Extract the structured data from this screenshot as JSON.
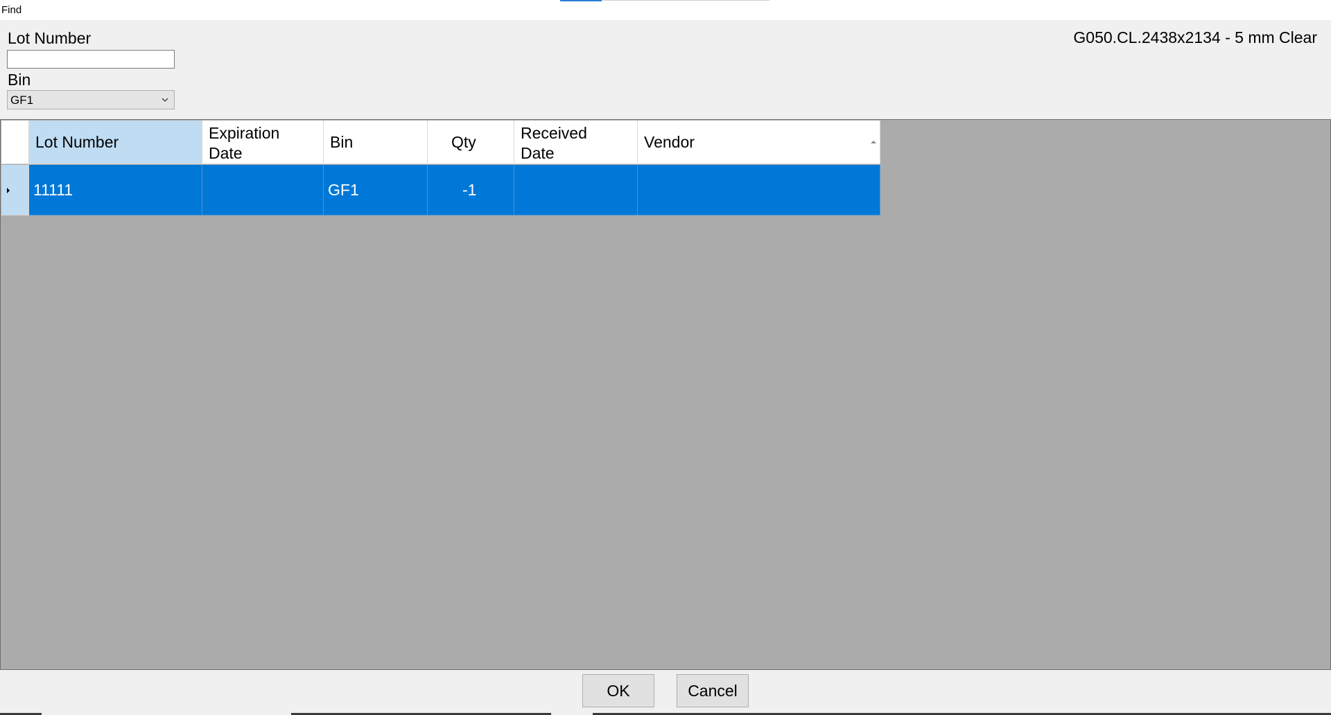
{
  "window": {
    "title": "Find"
  },
  "filters": {
    "lot_number_label": "Lot Number",
    "lot_number_value": "",
    "bin_label": "Bin",
    "bin_selected": "GF1"
  },
  "item_description": "G050.CL.2438x2134 - 5 mm Clear",
  "table": {
    "columns": [
      "Lot Number",
      "Expiration\nDate",
      "Bin",
      "Qty",
      "Received\nDate",
      "Vendor"
    ],
    "rows": [
      {
        "lot_number": "11111",
        "expiration_date": "",
        "bin": "GF1",
        "qty": "-1",
        "received_date": "",
        "vendor": ""
      }
    ],
    "selected_row": 0,
    "sorted_column": "Vendor",
    "sort_direction": "ascending"
  },
  "buttons": {
    "ok": "OK",
    "cancel": "Cancel"
  },
  "colors": {
    "selection": "#0078d7",
    "selected_header": "#bfdcf3",
    "grid_background": "#ababab",
    "window_background": "#f0f0f0"
  },
  "icons": {
    "dropdown": "chevron-down-icon",
    "sort": "sort-ascending-icon",
    "row_pointer": "row-pointer-icon"
  }
}
